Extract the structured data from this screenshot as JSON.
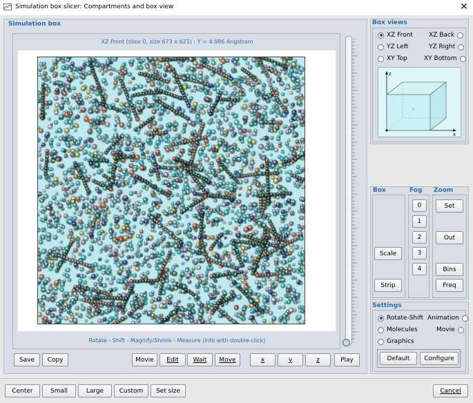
{
  "window": {
    "title": "Simulation box slicer: Compartments and box view",
    "close_glyph": "✕"
  },
  "sim": {
    "section_title": "Simulation box",
    "view_caption": "XZ Front (slice 0, size 673 x 621)  :  Y = 4.986 Angstrom",
    "help_caption": "Rotate - Shift - Magnify/Shrink - Measure (info with double-click)"
  },
  "bottom_bar": {
    "save": "Save",
    "copy": "Copy",
    "movie": "Movie",
    "edit": "Edit",
    "wait": "Wait",
    "move": "Move",
    "x": "x",
    "y": "y",
    "z": "z",
    "play": "Play"
  },
  "box_views": {
    "title": "Box views",
    "options": [
      {
        "label": "XZ Front",
        "selected": true
      },
      {
        "label": "XZ Back",
        "selected": false
      },
      {
        "label": "YZ Left",
        "selected": false
      },
      {
        "label": "YZ Right",
        "selected": false
      },
      {
        "label": "XY Top",
        "selected": false
      },
      {
        "label": "XY Bottom",
        "selected": false
      }
    ],
    "axis_z": "z",
    "axis_x": "x",
    "axis_y": "y"
  },
  "box_panel": {
    "title": "Box",
    "scale": "Scale",
    "strip": "Strip"
  },
  "fog_panel": {
    "title": "Fog",
    "levels": [
      "0",
      "1",
      "2",
      "3",
      "4"
    ]
  },
  "zoom_panel": {
    "title": "Zoom",
    "set": "Set",
    "out": "Out",
    "bins": "Bins",
    "freq": "Freq"
  },
  "settings": {
    "title": "Settings",
    "rotate_shift": "Rotate-Shift",
    "molecules": "Molecules",
    "graphics": "Graphics",
    "animation": "Animation",
    "movie": "Movie",
    "default": "Default",
    "configure": "Configure"
  },
  "footer": {
    "center": "Center",
    "small": "Small",
    "large": "Large",
    "custom": "Custom",
    "set_size": "Set size",
    "cancel": "Cancel"
  },
  "colors": {
    "accent": "#2f6ea8",
    "panel": "#d9dde6",
    "cyan_atom": "#39c6d0",
    "dark_chain": "#2f4f3a"
  }
}
